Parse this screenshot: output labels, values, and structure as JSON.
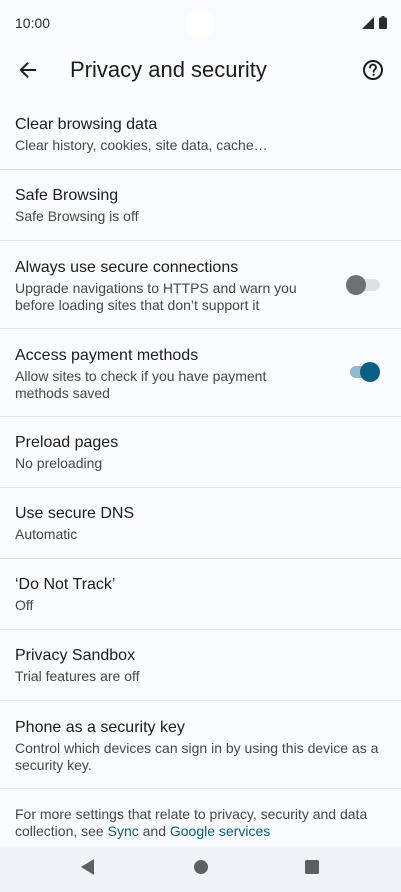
{
  "status_bar": {
    "time": "10:00",
    "icons": [
      "signal-icon",
      "battery-icon"
    ]
  },
  "app_bar": {
    "back_icon": "arrow-back-icon",
    "title": "Privacy and security",
    "help_icon": "help-circle-icon"
  },
  "settings": [
    {
      "title": "Clear browsing data",
      "summary": "Clear history, cookies, site data, cache…"
    },
    {
      "title": "Safe Browsing",
      "summary": "Safe Browsing is off"
    },
    {
      "title": "Always use secure connections",
      "summary": "Upgrade navigations to HTTPS and warn you before loading sites that don’t support it",
      "toggle_on": false
    },
    {
      "title": "Access payment methods",
      "summary": "Allow sites to check if you have payment methods saved",
      "toggle_on": true
    },
    {
      "title": "Preload pages",
      "summary": "No preloading"
    },
    {
      "title": "Use secure DNS",
      "summary": "Automatic"
    },
    {
      "title": "‘Do Not Track’",
      "summary": "Off"
    },
    {
      "title": "Privacy Sandbox",
      "summary": "Trial features are off"
    },
    {
      "title": "Phone as a security key",
      "summary": "Control which devices can sign in by using this device as a security key."
    }
  ],
  "footer": {
    "text_before": "For more settings that relate to privacy, security and data collection, see ",
    "link_sync": "Sync",
    "text_and": " and ",
    "link_google_services": "Google services"
  },
  "nav_bar": {
    "back_icon": "nav-back-triangle-icon",
    "home_icon": "nav-home-circle-icon",
    "recents_icon": "nav-recents-square-icon"
  },
  "colors": {
    "background": "#fafbfe",
    "accent": "#0b5e86",
    "divider": "#e4e4e8",
    "nav_bar": "#f2f3f7"
  }
}
